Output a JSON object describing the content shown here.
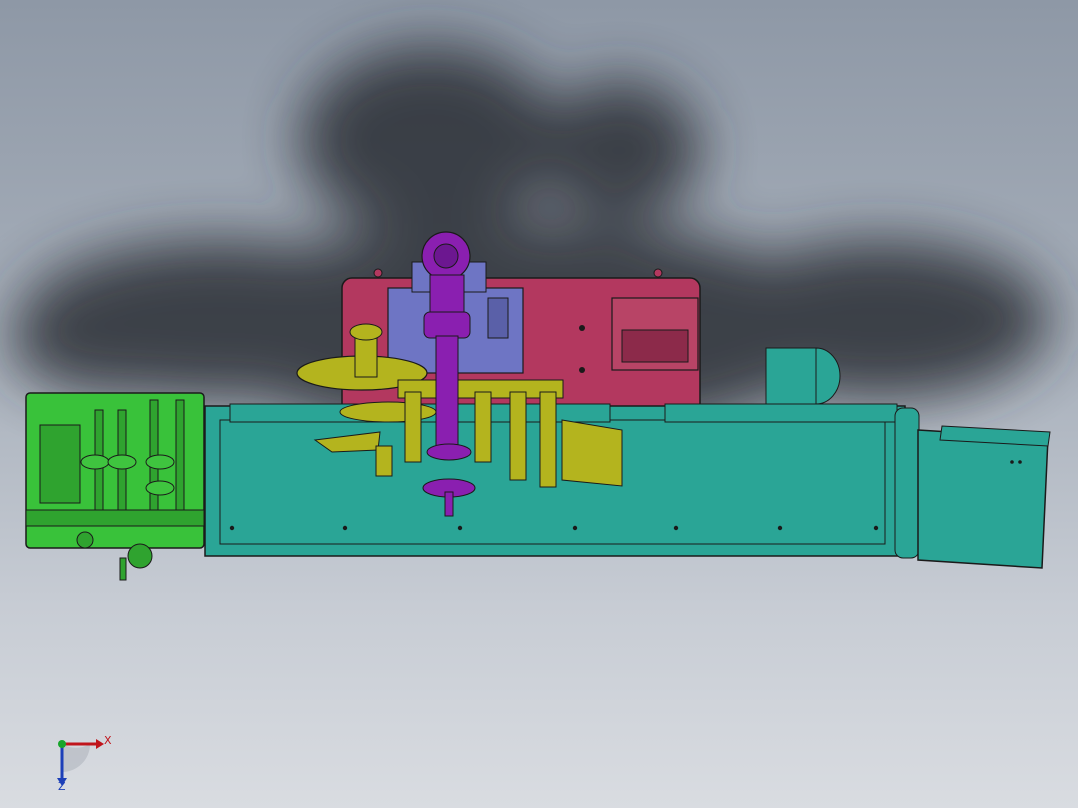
{
  "viewport": {
    "background_top": "#8e98a6",
    "background_bottom": "#d9dce1"
  },
  "model": {
    "colors": {
      "frame_green": "#39c23a",
      "conveyor_teal": "#2aa596",
      "cabinet_pink": "#b3385f",
      "labeler_yellow": "#b4b41e",
      "motor_purple": "#8a1fb0",
      "bracket_blue": "#6e75c4",
      "outline": "#1a1a1a"
    }
  },
  "triad": {
    "x_label": "X",
    "z_label": "Z",
    "x_color": "#c0141b",
    "y_color": "#17a52b",
    "z_color": "#1c3fb8"
  }
}
